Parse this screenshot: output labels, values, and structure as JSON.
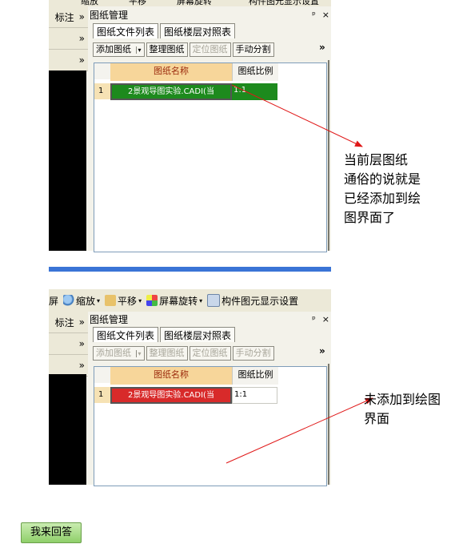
{
  "top_panel": {
    "toolbar_fragments": [
      "缩放",
      "平移",
      "屏幕旋转",
      "构件图元显示设置"
    ],
    "side_label": "标注",
    "side_chevrons": [
      "»",
      "»",
      "»"
    ],
    "title": "图纸管理",
    "pin": "ᵖ",
    "close": "×",
    "tabs": [
      "图纸文件列表",
      "图纸楼层对照表"
    ],
    "buttons": [
      {
        "label": "添加图纸",
        "disabled": false,
        "dropdown": true
      },
      {
        "label": "整理图纸",
        "disabled": false
      },
      {
        "label": "定位图纸",
        "disabled": true
      },
      {
        "label": "手动分割",
        "disabled": false
      }
    ],
    "more": "»",
    "columns": [
      "图纸名称",
      "图纸比例"
    ],
    "rows": [
      {
        "num": "1",
        "name": "2景观导图实验.CADI(当",
        "scale": "1:1",
        "color": "#1d8a1d"
      }
    ]
  },
  "bottom_panel": {
    "toolbar": [
      {
        "label": "屏",
        "icon": "screen-icon"
      },
      {
        "label": "缩放",
        "icon": "zoom-icon"
      },
      {
        "label": "平移",
        "icon": "pan-icon"
      },
      {
        "label": "屏幕旋转",
        "icon": "rotate-icon"
      },
      {
        "label": "构件图元显示设置",
        "icon": "display-settings-icon"
      }
    ],
    "side_label": "标注",
    "side_chevrons": [
      "»",
      "»",
      "»"
    ],
    "title": "图纸管理",
    "pin": "ᵖ",
    "close": "×",
    "tabs": [
      "图纸文件列表",
      "图纸楼层对照表"
    ],
    "buttons": [
      {
        "label": "添加图纸",
        "disabled": true,
        "dropdown": true
      },
      {
        "label": "整理图纸",
        "disabled": true
      },
      {
        "label": "定位图纸",
        "disabled": true
      },
      {
        "label": "手动分割",
        "disabled": true
      }
    ],
    "more": "»",
    "columns": [
      "图纸名称",
      "图纸比例"
    ],
    "rows": [
      {
        "num": "1",
        "name": "2景观导图实验.CADI(当",
        "scale": "1:1",
        "color": "#d82a2a"
      }
    ]
  },
  "annotations": {
    "top": [
      "当前层图纸",
      "通俗的说就是",
      "已经添加到绘",
      "图界面了"
    ],
    "bottom": [
      "未添加到绘图",
      "界面"
    ]
  },
  "answer_button": "我来回答"
}
